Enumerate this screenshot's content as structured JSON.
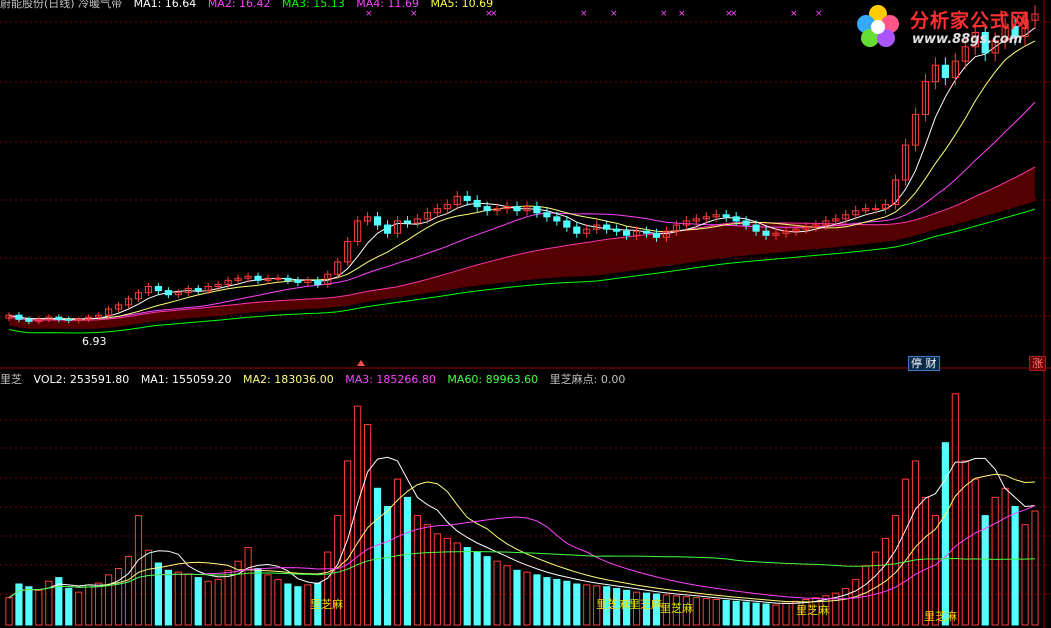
{
  "colors": {
    "bg": "#000000",
    "grid": "#7a0000",
    "up": "#ff3c3c",
    "down": "#54ffff",
    "ma1": "#ffffff",
    "ma2": "#ffff7a",
    "ma3": "#ff44ff",
    "ma4": "#00ff00",
    "ma5": "#c0c0c0",
    "ma60": "#44ff44",
    "ribbon": "#5a0000"
  },
  "top_header": {
    "title": "蔚能股份(日线) 冷暖气带",
    "ma1": "MA1: 16.64",
    "ma2": "MA2: 16.42",
    "ma3": "MA3: 15.13",
    "ma4": "MA4: 11.69",
    "ma5": "MA5: 10.69"
  },
  "bottom_header": {
    "name": "里芝",
    "vol2": "VOL2: 253591.80",
    "ma1": "MA1: 155059.20",
    "ma2": "MA2: 183036.00",
    "ma3": "MA3: 185266.80",
    "ma60": "MA60: 89963.60",
    "point": "里芝麻点: 0.00"
  },
  "badges": {
    "stop": "停 财",
    "rise": "涨"
  },
  "price_low_label": "6.93",
  "volume_labels": [
    {
      "text": "里芝麻"
    },
    {
      "text": "里芝麻里芝麻"
    },
    {
      "text": "里芝麻"
    },
    {
      "text": "里芝麻"
    },
    {
      "text": "里芝麻"
    }
  ],
  "logo": {
    "text": "分析家公式网",
    "url": "www.88gs.com"
  },
  "chart_data": {
    "type": "candlestick",
    "price_bars": 104,
    "price_range": [
      5.5,
      22
    ],
    "closes": [
      7.2,
      7.0,
      6.9,
      7.0,
      7.1,
      7.0,
      6.95,
      7.0,
      7.1,
      7.2,
      7.5,
      7.7,
      8.0,
      8.3,
      8.6,
      8.4,
      8.2,
      8.3,
      8.5,
      8.4,
      8.6,
      8.7,
      8.9,
      9.0,
      9.1,
      8.9,
      9.0,
      9.0,
      8.9,
      8.8,
      8.9,
      8.7,
      9.2,
      9.8,
      10.8,
      11.8,
      12.0,
      11.6,
      11.2,
      11.8,
      11.7,
      11.9,
      12.2,
      12.4,
      12.6,
      13.0,
      12.8,
      12.5,
      12.3,
      12.4,
      12.5,
      12.3,
      12.5,
      12.2,
      12.0,
      11.8,
      11.5,
      11.2,
      11.4,
      11.6,
      11.4,
      11.3,
      11.1,
      11.3,
      11.2,
      11.0,
      11.3,
      11.6,
      11.8,
      11.9,
      12.0,
      12.1,
      12.0,
      11.8,
      11.6,
      11.3,
      11.1,
      11.2,
      11.3,
      11.4,
      11.5,
      11.6,
      11.8,
      11.9,
      12.1,
      12.3,
      12.4,
      12.4,
      12.6,
      13.8,
      15.5,
      17.0,
      18.6,
      19.4,
      18.8,
      19.6,
      20.3,
      21.0,
      20.0,
      20.6,
      21.3,
      20.8,
      21.6,
      21.9
    ],
    "volume_bars": 104,
    "volume_range": [
      0,
      260000
    ],
    "volumes": [
      30000,
      45000,
      42000,
      38000,
      48000,
      52000,
      40000,
      36000,
      44000,
      46000,
      55000,
      62000,
      75000,
      120000,
      82000,
      68000,
      60000,
      58000,
      56000,
      52000,
      48000,
      50000,
      60000,
      70000,
      85000,
      62000,
      55000,
      50000,
      45000,
      42000,
      44000,
      46000,
      80000,
      120000,
      180000,
      240000,
      220000,
      150000,
      130000,
      160000,
      140000,
      120000,
      110000,
      100000,
      95000,
      90000,
      85000,
      80000,
      75000,
      70000,
      65000,
      60000,
      58000,
      55000,
      52000,
      50000,
      48000,
      45000,
      44000,
      43000,
      42000,
      40000,
      38000,
      36000,
      35000,
      34000,
      33000,
      32000,
      31000,
      30000,
      29000,
      28000,
      27000,
      26000,
      25000,
      24000,
      23000,
      22000,
      24000,
      26000,
      28000,
      30000,
      32000,
      35000,
      40000,
      50000,
      65000,
      80000,
      95000,
      120000,
      160000,
      180000,
      140000,
      120000,
      200000,
      253591,
      180000,
      160000,
      120000,
      140000,
      150000,
      130000,
      110000,
      125000
    ]
  }
}
